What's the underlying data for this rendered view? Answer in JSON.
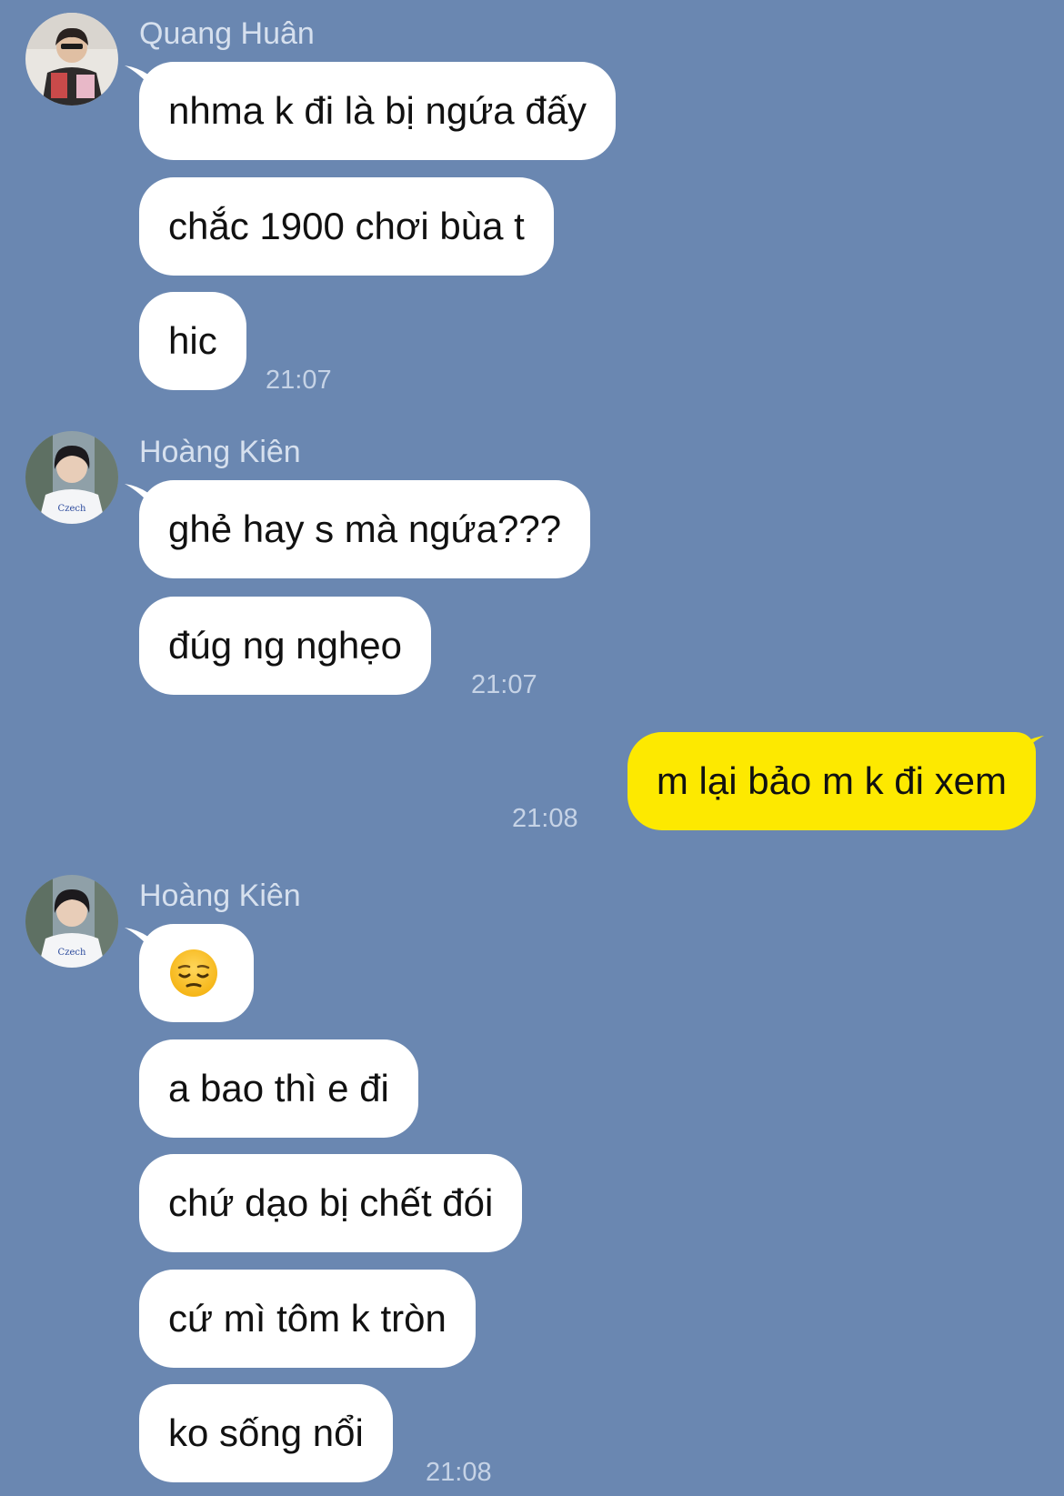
{
  "chat": {
    "groups": [
      {
        "sender": "Quang Huân",
        "avatar_icon": "avatar-quang-huan",
        "messages": [
          "nhma k đi là bị ngứa đấy",
          "chắc 1900 chơi bùa t",
          "hic"
        ],
        "time": "21:07"
      },
      {
        "sender": "Hoàng Kiên",
        "avatar_icon": "avatar-hoang-kien",
        "messages": [
          "ghẻ hay s mà ngứa???",
          "đúg ng nghẹo"
        ],
        "time": "21:07"
      },
      {
        "sender": "",
        "outgoing": true,
        "messages": [
          "m lại bảo m k đi xem"
        ],
        "time": "21:08"
      },
      {
        "sender": "Hoàng Kiên",
        "avatar_icon": "avatar-hoang-kien",
        "messages": [
          "pensive-face-emoji",
          "a bao thì e đi",
          "chứ dạo bị chết đói",
          "cứ mì tôm k tròn",
          "ko sống nổi"
        ],
        "time": "21:08"
      }
    ]
  },
  "colors": {
    "background": "#6a87b1",
    "incoming_bubble": "#ffffff",
    "outgoing_bubble": "#fde900",
    "sender_name": "#d6e0ee",
    "timestamp": "#c6d3e6"
  }
}
